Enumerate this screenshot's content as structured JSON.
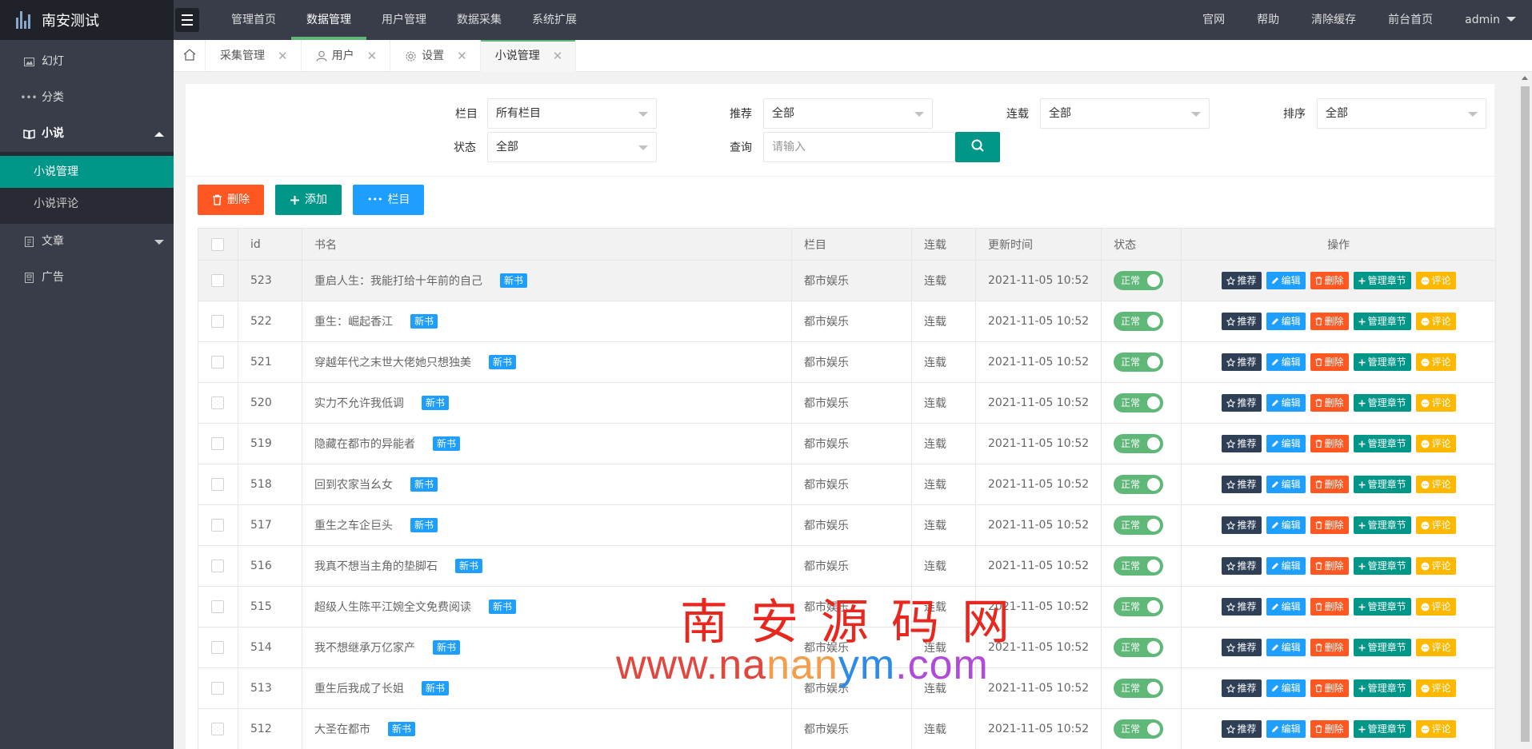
{
  "app": {
    "name": "南安测试"
  },
  "topnav": [
    {
      "label": "管理首页",
      "active": false
    },
    {
      "label": "数据管理",
      "active": true
    },
    {
      "label": "用户管理",
      "active": false
    },
    {
      "label": "数据采集",
      "active": false
    },
    {
      "label": "系统扩展",
      "active": false
    }
  ],
  "topright": [
    "官网",
    "帮助",
    "清除缓存",
    "前台首页",
    "admin"
  ],
  "sidebar": {
    "items": [
      {
        "label": "幻灯",
        "icon": "image-icon"
      },
      {
        "label": "分类",
        "icon": "dots-icon"
      },
      {
        "label": "小说",
        "icon": "book-icon",
        "open": true,
        "children": [
          {
            "label": "小说管理",
            "active": true
          },
          {
            "label": "小说评论",
            "active": false
          }
        ]
      },
      {
        "label": "文章",
        "icon": "file-icon"
      },
      {
        "label": "广告",
        "icon": "ad-icon"
      }
    ]
  },
  "tabs": [
    {
      "label": "采集管理"
    },
    {
      "label": "用户",
      "icon": "user-icon"
    },
    {
      "label": "设置",
      "icon": "gear-icon"
    },
    {
      "label": "小说管理",
      "active": true
    }
  ],
  "filters": {
    "category_label": "栏目",
    "category_value": "所有栏目",
    "recommend_label": "推荐",
    "recommend_value": "全部",
    "serial_label": "连载",
    "serial_value": "全部",
    "sort_label": "排序",
    "sort_value": "全部",
    "status_label": "状态",
    "status_value": "全部",
    "query_label": "查询",
    "query_placeholder": "请输入"
  },
  "actions": {
    "delete": "删除",
    "add": "添加",
    "column": "栏目"
  },
  "table": {
    "headers": {
      "id": "id",
      "name": "书名",
      "column": "栏目",
      "serial": "连载",
      "updated": "更新时间",
      "status": "状态",
      "ops": "操作"
    },
    "badge": "新书",
    "status_text": "正常",
    "op_labels": {
      "recommend": "推荐",
      "edit": "编辑",
      "delete": "删除",
      "chapters": "管理章节",
      "comment": "评论"
    },
    "rows": [
      {
        "id": "523",
        "name": "重启人生：我能打给十年前的自己",
        "column": "都市娱乐",
        "serial": "连载",
        "updated": "2021-11-05 10:52"
      },
      {
        "id": "522",
        "name": "重生：崛起香江",
        "column": "都市娱乐",
        "serial": "连载",
        "updated": "2021-11-05 10:52"
      },
      {
        "id": "521",
        "name": "穿越年代之末世大佬她只想独美",
        "column": "都市娱乐",
        "serial": "连载",
        "updated": "2021-11-05 10:52"
      },
      {
        "id": "520",
        "name": "实力不允许我低调",
        "column": "都市娱乐",
        "serial": "连载",
        "updated": "2021-11-05 10:52"
      },
      {
        "id": "519",
        "name": "隐藏在都市的异能者",
        "column": "都市娱乐",
        "serial": "连载",
        "updated": "2021-11-05 10:52"
      },
      {
        "id": "518",
        "name": "回到农家当幺女",
        "column": "都市娱乐",
        "serial": "连载",
        "updated": "2021-11-05 10:52"
      },
      {
        "id": "517",
        "name": "重生之车企巨头",
        "column": "都市娱乐",
        "serial": "连载",
        "updated": "2021-11-05 10:52"
      },
      {
        "id": "516",
        "name": "我真不想当主角的垫脚石",
        "column": "都市娱乐",
        "serial": "连载",
        "updated": "2021-11-05 10:52"
      },
      {
        "id": "515",
        "name": "超级人生陈平江婉全文免费阅读",
        "column": "都市娱乐",
        "serial": "连载",
        "updated": "2021-11-05 10:52"
      },
      {
        "id": "514",
        "name": "我不想继承万亿家产",
        "column": "都市娱乐",
        "serial": "连载",
        "updated": "2021-11-05 10:52"
      },
      {
        "id": "513",
        "name": "重生后我成了长姐",
        "column": "都市娱乐",
        "serial": "连载",
        "updated": "2021-11-05 10:52"
      },
      {
        "id": "512",
        "name": "大圣在都市",
        "column": "都市娱乐",
        "serial": "连载",
        "updated": "2021-11-05 10:52"
      }
    ]
  },
  "watermark": {
    "cn": "南安源码网",
    "url_a": "www.na",
    "url_b": "nan",
    "url_c": "ym",
    "url_d": ".com"
  },
  "colors": {
    "primary": "#009688",
    "danger": "#ff5722",
    "info": "#1e9fff",
    "dark": "#2f4056",
    "warn": "#ffb800",
    "header": "#393d49"
  }
}
